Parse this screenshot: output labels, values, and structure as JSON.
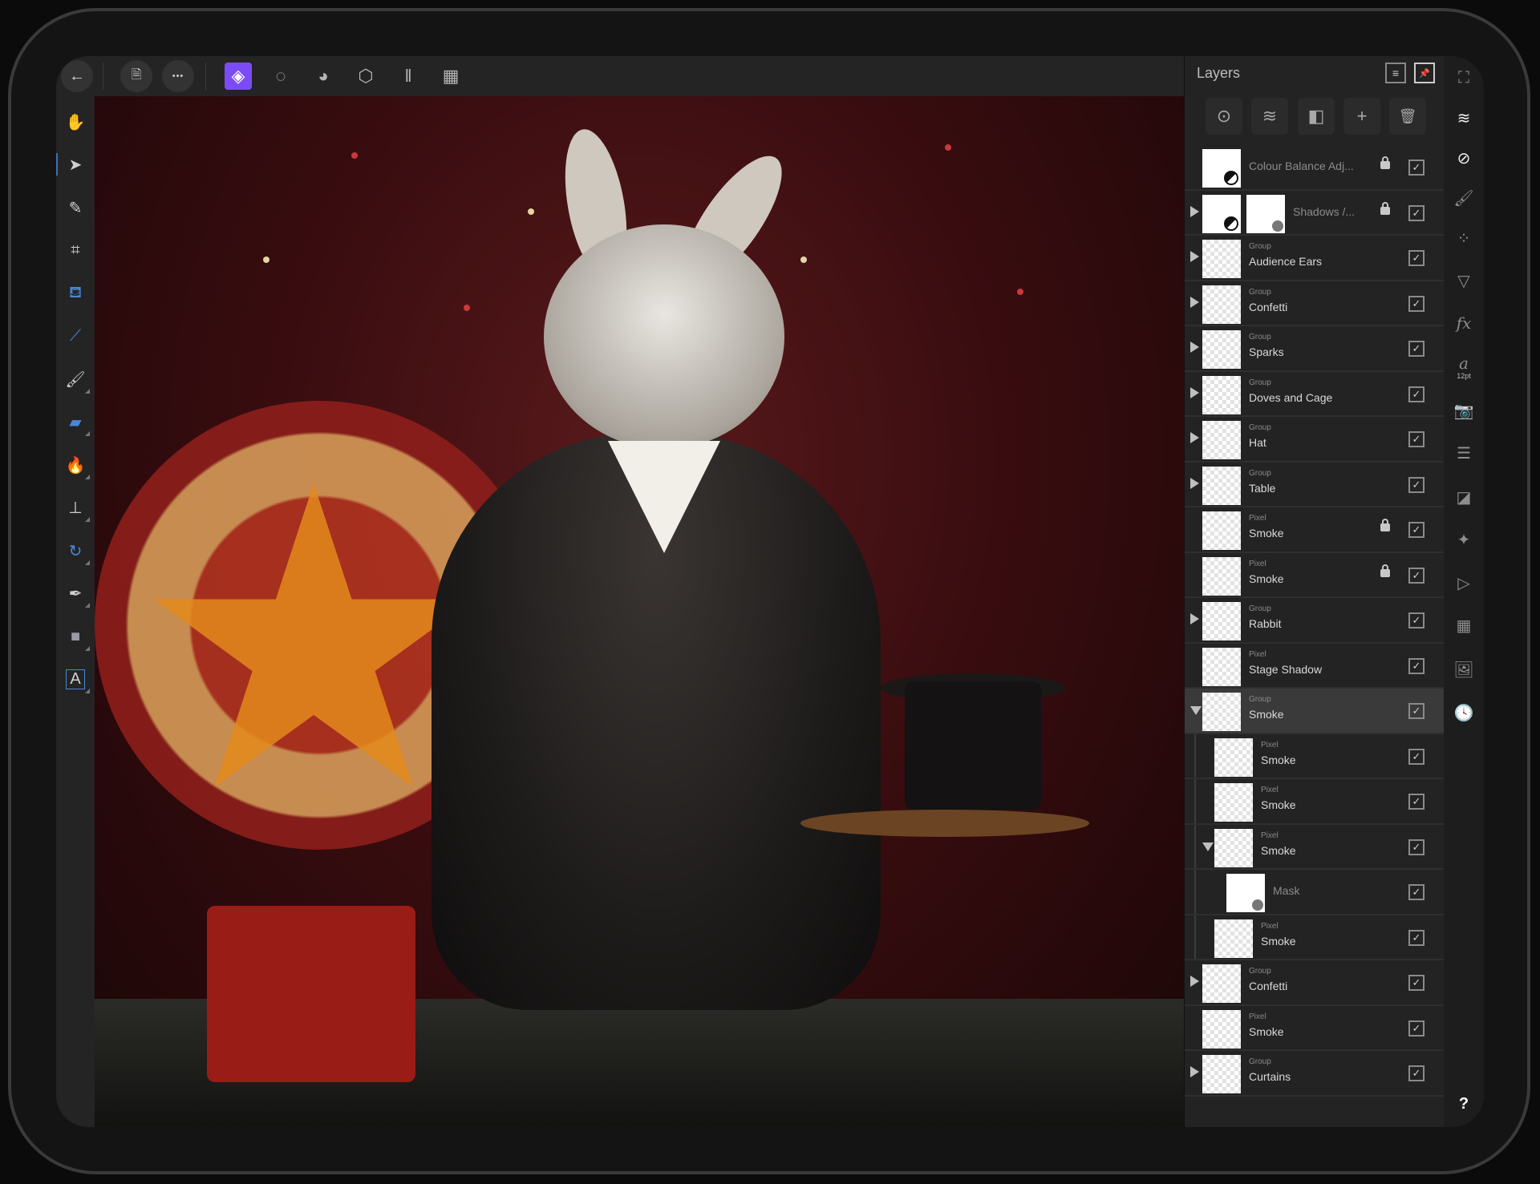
{
  "toolbar": {
    "back": {
      "icon": "arrow-left-icon",
      "glyph": "←"
    },
    "document": {
      "icon": "document-icon",
      "glyph": "🗎"
    },
    "more": {
      "icon": "ellipsis-icon",
      "glyph": "•••"
    },
    "personas": [
      {
        "name": "photo-persona",
        "glyph": "◈",
        "active": true
      },
      {
        "name": "liquify-persona",
        "glyph": "◌"
      },
      {
        "name": "develop-persona",
        "glyph": "◕"
      },
      {
        "name": "tone-mapping-persona",
        "glyph": "⬡"
      },
      {
        "name": "export-persona",
        "glyph": "‖"
      }
    ],
    "window_toggle": {
      "icon": "layout-icon",
      "glyph": "▦"
    },
    "accent": "#7b4cf5"
  },
  "tools": [
    {
      "name": "hand-tool",
      "glyph": "✋"
    },
    {
      "name": "move-tool",
      "glyph": "➤",
      "active": true
    },
    {
      "name": "color-picker-tool",
      "glyph": "✎"
    },
    {
      "name": "crop-tool",
      "glyph": "⌗"
    },
    {
      "name": "fill-tool",
      "glyph": "⛾"
    },
    {
      "name": "selection-brush-tool",
      "glyph": "⟋"
    },
    {
      "name": "paint-brush-tool",
      "glyph": "🖌",
      "more": true
    },
    {
      "name": "erase-brush-tool",
      "glyph": "▰",
      "more": true
    },
    {
      "name": "dodge-burn-tool",
      "glyph": "🔥",
      "more": true
    },
    {
      "name": "clone-tool",
      "glyph": "⊥",
      "more": true
    },
    {
      "name": "smudge-tool",
      "glyph": "↻",
      "more": true
    },
    {
      "name": "pen-tool",
      "glyph": "✒",
      "more": true
    },
    {
      "name": "shape-tool",
      "glyph": "■",
      "more": true
    },
    {
      "name": "text-tool",
      "glyph": "A",
      "more": true
    }
  ],
  "layers_panel": {
    "title": "Layers",
    "header_buttons": [
      {
        "name": "panel-menu-button",
        "glyph": "≡"
      },
      {
        "name": "pin-panel-button",
        "glyph": "📌"
      }
    ],
    "actions": [
      {
        "name": "layer-options-button",
        "glyph": "⊙"
      },
      {
        "name": "layer-stack-button",
        "glyph": "≋"
      },
      {
        "name": "add-mask-button",
        "glyph": "◧"
      },
      {
        "name": "add-layer-button",
        "glyph": "+"
      },
      {
        "name": "delete-layer-button",
        "glyph": "🗑"
      }
    ],
    "rows": [
      {
        "type": "",
        "name": "Colour Balance Adj...",
        "kind": "adjustment",
        "locked": true,
        "visible": true,
        "expander": "none",
        "dim": true,
        "indent": 0
      },
      {
        "type": "",
        "name": "Shadows /...",
        "kind": "adjustment-mask",
        "locked": true,
        "visible": true,
        "expander": "closed",
        "dim": true,
        "indent": 0
      },
      {
        "type": "Group",
        "name": "Audience Ears",
        "visible": true,
        "expander": "closed",
        "indent": 0
      },
      {
        "type": "Group",
        "name": "Confetti",
        "visible": true,
        "expander": "closed",
        "indent": 0
      },
      {
        "type": "Group",
        "name": "Sparks",
        "visible": true,
        "expander": "closed",
        "indent": 0
      },
      {
        "type": "Group",
        "name": "Doves and Cage",
        "visible": true,
        "expander": "closed",
        "indent": 0
      },
      {
        "type": "Group",
        "name": "Hat",
        "visible": true,
        "expander": "closed",
        "indent": 0
      },
      {
        "type": "Group",
        "name": "Table",
        "visible": true,
        "expander": "closed",
        "indent": 0
      },
      {
        "type": "Pixel",
        "name": "Smoke",
        "locked": true,
        "visible": true,
        "expander": "none",
        "indent": 0
      },
      {
        "type": "Pixel",
        "name": "Smoke",
        "locked": true,
        "visible": true,
        "expander": "none",
        "indent": 0
      },
      {
        "type": "Group",
        "name": "Rabbit",
        "visible": true,
        "expander": "closed",
        "indent": 0
      },
      {
        "type": "Pixel",
        "name": "Stage Shadow",
        "visible": true,
        "expander": "none",
        "indent": 0
      },
      {
        "type": "Group",
        "name": "Smoke",
        "visible": true,
        "expander": "open",
        "selected": true,
        "indent": 0
      },
      {
        "type": "Pixel",
        "name": "Smoke",
        "visible": true,
        "expander": "none",
        "indent": 1
      },
      {
        "type": "Pixel",
        "name": "Smoke",
        "visible": true,
        "expander": "none",
        "indent": 1
      },
      {
        "type": "Pixel",
        "name": "Smoke",
        "visible": true,
        "expander": "open",
        "indent": 1
      },
      {
        "type": "",
        "name": "Mask",
        "kind": "mask",
        "visible": true,
        "expander": "none",
        "dim": true,
        "indent": 2
      },
      {
        "type": "Pixel",
        "name": "Smoke",
        "visible": true,
        "expander": "none",
        "indent": 1
      },
      {
        "type": "Group",
        "name": "Confetti",
        "visible": true,
        "expander": "closed",
        "indent": 0
      },
      {
        "type": "Pixel",
        "name": "Smoke",
        "visible": true,
        "expander": "none",
        "indent": 0
      },
      {
        "type": "Group",
        "name": "Curtains",
        "visible": true,
        "expander": "closed",
        "indent": 0
      }
    ],
    "check_glyph": "✓"
  },
  "studio": {
    "items": [
      {
        "name": "transform-panel",
        "glyph": "⛶"
      },
      {
        "name": "layers-panel",
        "glyph": "≋",
        "active": true
      },
      {
        "name": "adjustments-panel",
        "glyph": "⊘",
        "active": true
      },
      {
        "name": "brushes-panel",
        "glyph": "🖌"
      },
      {
        "name": "swatches-panel",
        "glyph": "⁘"
      },
      {
        "name": "filters-panel",
        "glyph": "▽"
      },
      {
        "name": "effects-panel",
        "glyph": "fx"
      },
      {
        "name": "text-style-panel",
        "glyph": "a",
        "sub": "12pt"
      },
      {
        "name": "snapshots-panel",
        "glyph": "📷"
      },
      {
        "name": "adjust-sliders-panel",
        "glyph": "☰"
      },
      {
        "name": "channels-panel",
        "glyph": "◪"
      },
      {
        "name": "navigator-panel",
        "glyph": "✦"
      },
      {
        "name": "macro-panel",
        "glyph": "▷"
      },
      {
        "name": "library-panel",
        "glyph": "▦"
      },
      {
        "name": "stock-panel",
        "glyph": "🖼"
      },
      {
        "name": "history-panel",
        "glyph": "🕓"
      }
    ],
    "help": "?"
  }
}
